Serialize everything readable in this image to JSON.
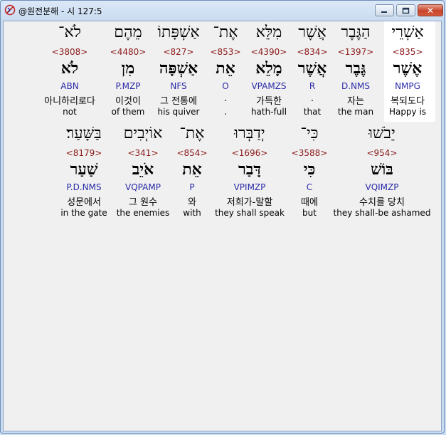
{
  "window": {
    "title": "@원전분해 - 시 127:5",
    "close_glyph": "✕"
  },
  "rows": [
    {
      "words": [
        {
          "hebrew": "אַשְׁרֵי",
          "strong": "<835>",
          "lemma": "אֶשֶׁר",
          "parse": "NMPG",
          "korean": "복되도다",
          "english": "Happy is",
          "highlighted": true
        },
        {
          "hebrew": "הַגֶּבֶר",
          "strong": "<1397>",
          "lemma": "גֶּבֶר",
          "parse": "D.NMS",
          "korean": "자는",
          "english": "the man"
        },
        {
          "hebrew": "אֲשֶׁר",
          "strong": "<834>",
          "lemma": "אֲשֶׁר",
          "parse": "R",
          "korean": ".",
          "english": "that"
        },
        {
          "hebrew": "מִלֵּא",
          "strong": "<4390>",
          "lemma": "מָלֵא",
          "parse": "VPAMZS",
          "korean": "가득한",
          "english": "hath-full"
        },
        {
          "hebrew": "אֶת־",
          "strong": "<853>",
          "lemma": "אֵת",
          "parse": "O",
          "korean": ".",
          "english": "."
        },
        {
          "hebrew": "אַשְׁפָּתוֹ",
          "strong": "<827>",
          "lemma": "אַשְׁפָּה",
          "parse": "NFS",
          "korean": "그 전통에",
          "english": "his quiver"
        },
        {
          "hebrew": "מֵהֶם",
          "strong": "<4480>",
          "lemma": "מִן",
          "parse": "P.MZP",
          "korean": "이것이",
          "english": "of them"
        },
        {
          "hebrew": "לֹא־",
          "strong": "<3808>",
          "lemma": "לֹא",
          "parse": "ABN",
          "korean": "아니하리로다",
          "english": "not"
        }
      ]
    },
    {
      "words": [
        {
          "hebrew": "יֵבֹשׁוּ",
          "strong": "<954>",
          "lemma": "בּוֹשׁ",
          "parse": "VQIMZP",
          "korean": "수치를 당치",
          "english": "they shall-be ashamed"
        },
        {
          "hebrew": "כִּי־",
          "strong": "<3588>",
          "lemma": "כִּי",
          "parse": "C",
          "korean": "때에",
          "english": "but"
        },
        {
          "hebrew": "יְדַבְּרוּ",
          "strong": "<1696>",
          "lemma": "דָּבַר",
          "parse": "VPIMZP",
          "korean": "저희가-말할",
          "english": "they shall speak"
        },
        {
          "hebrew": "אֶת־",
          "strong": "<854>",
          "lemma": "אֵת",
          "parse": "P",
          "korean": "와",
          "english": "with"
        },
        {
          "hebrew": "אוֹיְבִים",
          "strong": "<341>",
          "lemma": "אֹיֵב",
          "parse": "VQPAMP",
          "korean": "그 원수",
          "english": "the enemies"
        },
        {
          "hebrew": "בַּשָּׁעַר׃",
          "strong": "<8179>",
          "lemma": "שַׁעַר",
          "parse": "P.D.NMS",
          "korean": "성문에서",
          "english": "in the gate"
        }
      ]
    }
  ]
}
